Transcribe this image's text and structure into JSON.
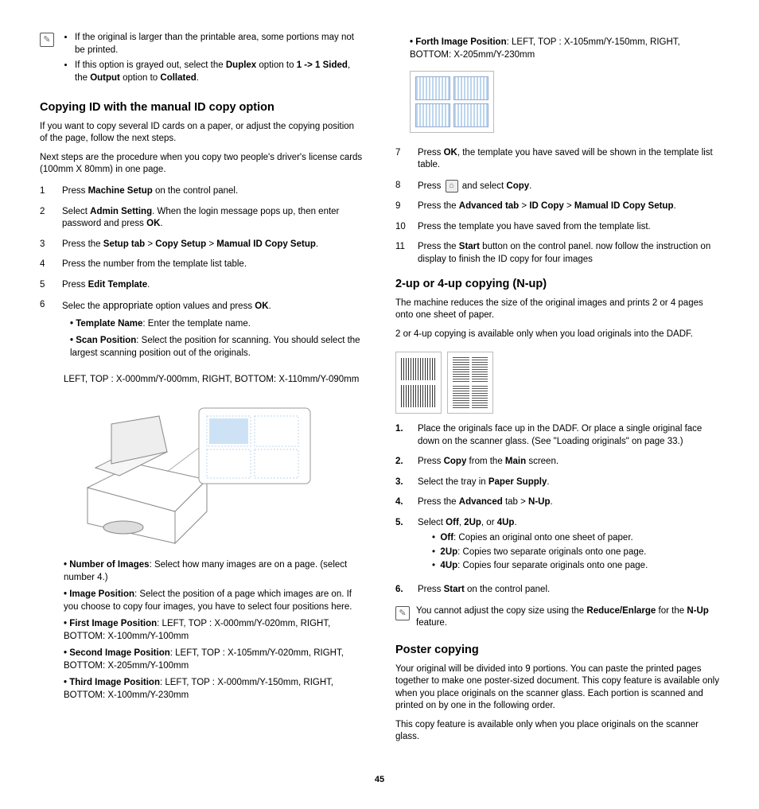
{
  "pageNumber": "45",
  "left": {
    "topNote": {
      "b1a": "If the original is larger than the printable area, some portions may not be printed.",
      "b2a": "If this option is grayed out, select the ",
      "b2b": "Duplex",
      "b2c": " option to ",
      "b2d": "1 -> 1 Sided",
      "b2e": ", the ",
      "b2f": "Output",
      "b2g": " option to ",
      "b2h": "Collated",
      "b2i": "."
    },
    "h1": "Copying ID with the manual ID copy option",
    "p1": "If you want to copy several ID cards on a paper, or adjust the copying position of the page, follow the next steps.",
    "p2": "Next steps are the procedure when you copy two people's driver's license cards (100mm X 80mm) in one page.",
    "s1": {
      "n": "1",
      "a": "Press ",
      "b": "Machine Setup",
      "c": " on the control panel."
    },
    "s2": {
      "n": "2",
      "a": "Select ",
      "b": "Admin Setting",
      "c": ". When the login message pops up, then enter password and press ",
      "d": "OK",
      "e": "."
    },
    "s3": {
      "n": "3",
      "a": "Press the ",
      "b": "Setup tab",
      "c": " > ",
      "d": "Copy Setup",
      "e": " > ",
      "f": "Mamual ID Copy Setup",
      "g": "."
    },
    "s4": {
      "n": "4",
      "a": "Press the number from the template list table."
    },
    "s5": {
      "n": "5",
      "a": "Press ",
      "b": "Edit Template",
      "c": "."
    },
    "s6": {
      "n": "6",
      "a": "Selec the ",
      "b": "appropriate",
      "c": " option values and press ",
      "d": "OK",
      "e": "."
    },
    "s6b1": {
      "a": "Template Name",
      "b": ": Enter the template name."
    },
    "s6b2": {
      "a": "Scan Position",
      "b": ": Select the position for scanning. You should select the largest scanning position out of the originals."
    },
    "scanPos": "LEFT, TOP : X-000mm/Y-000mm, RIGHT, BOTTOM: X-110mm/Y-090mm",
    "b_num": {
      "a": "Number of Images",
      "b": ": Select how many images are on a page. (select number 4.)"
    },
    "b_imgpos": {
      "a": "Image Position",
      "b": ": Select the position of a page which images are on. If you choose to copy four images, you have to select four positions here."
    },
    "b_first": {
      "a": "First Image Position",
      "b": ": LEFT, TOP : X-000mm/Y-020mm, RIGHT, BOTTOM: X-100mm/Y-100mm"
    },
    "b_second": {
      "a": "Second Image Position",
      "b": ": LEFT, TOP : X-105mm/Y-020mm, RIGHT, BOTTOM: X-205mm/Y-100mm"
    },
    "b_third": {
      "a": "Third Image Position",
      "b": ": LEFT, TOP : X-000mm/Y-150mm, RIGHT, BOTTOM: X-100mm/Y-230mm"
    }
  },
  "right": {
    "b_forth": {
      "a": "Forth Image Position",
      "b": ": LEFT, TOP : X-105mm/Y-150mm, RIGHT, BOTTOM: X-205mm/Y-230mm"
    },
    "s7": {
      "n": "7",
      "a": "Press ",
      "b": "OK",
      "c": ", the template you have saved will be shown in the template list table."
    },
    "s8": {
      "n": "8",
      "a": "Press ",
      "b": " and select ",
      "c": "Copy",
      "d": "."
    },
    "s9": {
      "n": "9",
      "a": "Press the ",
      "b": "Advanced tab",
      "c": " > ",
      "d": "ID Copy",
      "e": " > ",
      "f": "Mamual ID Copy Setup",
      "g": "."
    },
    "s10": {
      "n": "10",
      "a": "Press the template you have saved from the template list."
    },
    "s11": {
      "n": "11",
      "a": "Press the ",
      "b": "Start",
      "c": " button on the control panel. now follow the instruction on display to finish the ID copy for four images"
    },
    "h2": "2-up or 4-up copying (N-up)",
    "p_nup1": "The machine reduces the size of the original images and prints 2 or 4 pages onto one sheet of paper.",
    "p_nup2": "2 or 4-up copying is available only when you load originals into the DADF.",
    "n1": {
      "n": "1.",
      "a": "Place the originals face up in the DADF. Or place a single original face down on the scanner glass. (See \"Loading originals\" on page 33.)"
    },
    "n2": {
      "n": "2.",
      "a": "Press ",
      "b": "Copy",
      "c": " from the ",
      "d": "Main",
      "e": " screen."
    },
    "n3": {
      "n": "3.",
      "a": "Select the tray in ",
      "b": "Paper Supply",
      "c": "."
    },
    "n4": {
      "n": "4.",
      "a": "Press the ",
      "b": "Advanced",
      "c": " tab > ",
      "d": "N-Up",
      "e": "."
    },
    "n5": {
      "n": "5.",
      "a": "Select ",
      "b": "Off",
      "c": ", ",
      "d": "2Up",
      "e": ", or ",
      "f": "4Up",
      "g": "."
    },
    "n5s1": {
      "a": "Off",
      "b": ": Copies an original onto one sheet of paper."
    },
    "n5s2": {
      "a": "2Up",
      "b": ": Copies two separate originals onto one page."
    },
    "n5s3": {
      "a": "4Up",
      "b": ": Copies four separate originals onto one page."
    },
    "n6": {
      "n": "6.",
      "a": "Press ",
      "b": "Start",
      "c": " on the control panel."
    },
    "note2a": "You cannot adjust the copy size using the ",
    "note2b": "Reduce/Enlarge",
    "note2c": " for the ",
    "note2d": "N-Up",
    "note2e": " feature.",
    "h3": "Poster copying",
    "p_post1": "Your original will be divided into 9 portions. You can paste the printed pages together to make one poster-sized document. This copy feature is available only when you place originals on the scanner glass. Each portion is scanned and printed on by one in the following order.",
    "p_post2": "This copy feature is available only when you place originals on the scanner glass."
  }
}
